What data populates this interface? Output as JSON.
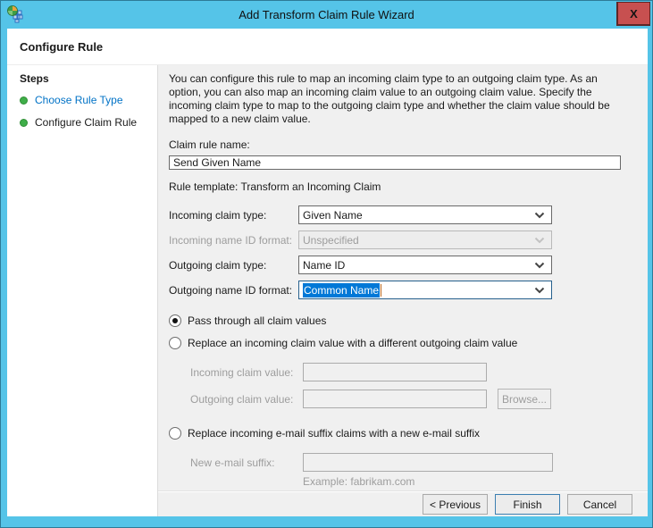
{
  "window": {
    "title": "Add Transform Claim Rule Wizard",
    "close_label": "X",
    "page_header": "Configure Rule"
  },
  "sidebar": {
    "heading": "Steps",
    "items": [
      {
        "label": "Choose Rule Type"
      },
      {
        "label": "Configure Claim Rule"
      }
    ]
  },
  "main": {
    "description": "You can configure this rule to map an incoming claim type to an outgoing claim type. As an option, you can also map an incoming claim value to an outgoing claim value. Specify the incoming claim type to map to the outgoing claim type and whether the claim value should be mapped to a new claim value.",
    "claim_rule_name": {
      "label": "Claim rule name:",
      "value": "Send Given Name"
    },
    "rule_template": "Rule template: Transform an Incoming Claim",
    "incoming_claim_type": {
      "label": "Incoming claim type:",
      "value": "Given Name"
    },
    "incoming_name_id_format": {
      "label": "Incoming name ID format:",
      "value": "Unspecified"
    },
    "outgoing_claim_type": {
      "label": "Outgoing claim type:",
      "value": "Name ID"
    },
    "outgoing_name_id_format": {
      "label": "Outgoing name ID format:",
      "value": "Common Name"
    },
    "options": {
      "pass_through": "Pass through all claim values",
      "replace_value": "Replace an incoming claim value with a different outgoing claim value",
      "replace_email": "Replace incoming e-mail suffix claims with a new e-mail suffix"
    },
    "claim_values": {
      "incoming_label": "Incoming claim value:",
      "outgoing_label": "Outgoing claim value:",
      "browse_label": "Browse...",
      "new_email_label": "New e-mail suffix:",
      "example": "Example: fabrikam.com"
    }
  },
  "footer": {
    "previous": "< Previous",
    "finish": "Finish",
    "cancel": "Cancel"
  },
  "colors": {
    "accent_blue": "#55c4e8",
    "selection_blue": "#0078d7",
    "step_green": "#3fae49",
    "link_blue": "#0072c6",
    "close_red": "#c75050"
  }
}
